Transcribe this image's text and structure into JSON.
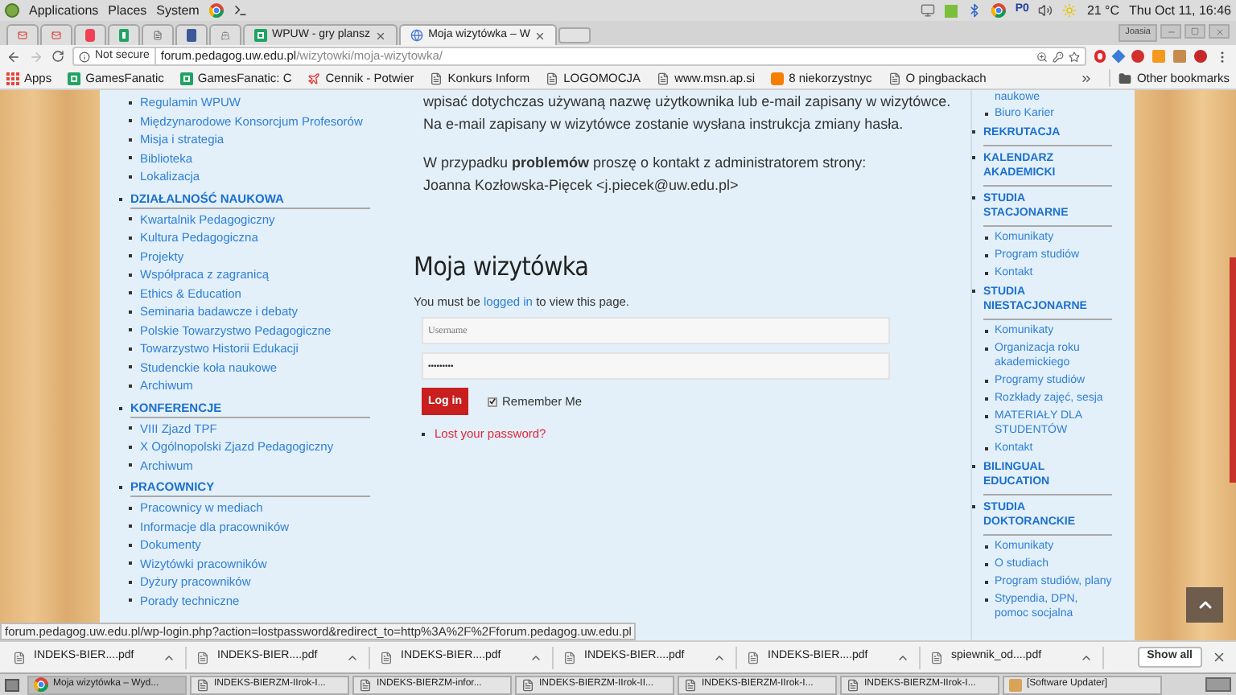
{
  "system_panel": {
    "menus": [
      "Applications",
      "Places",
      "System"
    ],
    "keyboard": "P0",
    "weather": "21 °C",
    "clock": "Thu Oct 11, 16:46"
  },
  "tabs": [
    {
      "kind": "gmail",
      "selected": false
    },
    {
      "kind": "gmail",
      "selected": false
    },
    {
      "kind": "pocket",
      "selected": false
    },
    {
      "kind": "sheets",
      "selected": false
    },
    {
      "kind": "doc",
      "selected": false
    },
    {
      "kind": "facebook",
      "selected": false
    },
    {
      "kind": "ship",
      "selected": false
    },
    {
      "kind": "sheets",
      "title": "WPUW - gry plansz",
      "selected": false
    },
    {
      "kind": "globe",
      "title": "Moja wizytówka – W",
      "selected": true
    }
  ],
  "profile": "Joasia",
  "address_bar": {
    "security": "Not secure",
    "host": "forum.pedagog.uw.edu.pl",
    "path": "/wizytowki/moja-wizytowka/"
  },
  "bookmarks": [
    {
      "kind": "apps",
      "label": "Apps"
    },
    {
      "kind": "sheets",
      "label": "GamesFanatic"
    },
    {
      "kind": "sheets",
      "label": "GamesFanatic: C"
    },
    {
      "kind": "plane",
      "label": "Cennik - Potwier"
    },
    {
      "kind": "doc",
      "label": "Konkurs Inform"
    },
    {
      "kind": "doc",
      "label": "LOGOMOCJA"
    },
    {
      "kind": "doc",
      "label": "www.msn.ap.si"
    },
    {
      "kind": "blogger",
      "label": "8 niekorzystnyc"
    },
    {
      "kind": "doc",
      "label": "O pingbackach"
    }
  ],
  "other_bookmarks": "Other bookmarks",
  "left_menu": [
    {
      "items": [
        "Regulamin WPUW",
        "Międzynarodowe Konsorcjum Profesorów",
        "Misja i strategia",
        "Biblioteka",
        "Lokalizacja"
      ]
    },
    {
      "heading": "DZIAŁALNOŚĆ NAUKOWA",
      "items": [
        "Kwartalnik Pedagogiczny",
        "Kultura Pedagogiczna",
        "Projekty",
        "Współpraca z zagranicą",
        "Ethics & Education",
        "Seminaria badawcze i debaty",
        "Polskie Towarzystwo Pedagogiczne",
        "Towarzystwo Historii Edukacji",
        "Studenckie koła naukowe",
        "Archiwum"
      ]
    },
    {
      "heading": "KONFERENCJE",
      "items": [
        "VIII Zjazd TPF",
        "X Ogólnopolski Zjazd Pedagogiczny",
        "Archiwum"
      ]
    },
    {
      "heading": "PRACOWNICY",
      "items": [
        "Pracownicy w mediach",
        "Informacje dla pracowników",
        "Dokumenty",
        "Wizytówki pracowników",
        "Dyżury pracowników",
        "Porady techniczne"
      ]
    }
  ],
  "content": {
    "paragraphs": [
      [
        "wpisać dotychczas używaną nazwę użytkownika lub e-mail zapisany w wizytówce.",
        "Na e-mail zapisany w wizytówce zostanie wysłana instrukcja zmiany hasła."
      ],
      [
        "W przypadku **problemów** proszę o kontakt z administratorem strony:",
        "Joanna Kozłowska-Pięcek <j.piecek@uw.edu.pl>"
      ]
    ],
    "heading": "Moja wizytówka",
    "notice_before": "You must be",
    "notice_link": "logged in",
    "notice_after": "to view this page.",
    "username_placeholder": "Username",
    "password_value": "•••••••••",
    "login_button": "Log in",
    "remember_me": {
      "label": "Remember Me",
      "checked": true
    },
    "lost_password": "Lost your password?"
  },
  "right_menu": {
    "cut_item": "naukowe",
    "sections": [
      {
        "items": [
          "Biuro Karier"
        ]
      },
      {
        "heading": "REKRUTACJA"
      },
      {
        "heading": "KALENDARZ AKADEMICKI"
      },
      {
        "heading": "STUDIA STACJONARNE",
        "items": [
          "Komunikaty",
          "Program studiów",
          "Kontakt"
        ]
      },
      {
        "heading": "STUDIA NIESTACJONARNE",
        "items": [
          "Komunikaty",
          "Organizacja roku akademickiego",
          "Programy studiów",
          "Rozkłady zajęć, sesja",
          "MATERIAŁY DLA STUDENTÓW",
          "Kontakt"
        ]
      },
      {
        "heading": "BILINGUAL EDUCATION"
      },
      {
        "heading": "STUDIA DOKTORANCKIE",
        "items": [
          "Komunikaty",
          "O studiach",
          "Program studiów, plany",
          "Stypendia, DPN, pomoc socjalna"
        ]
      }
    ]
  },
  "status_url": "forum.pedagog.uw.edu.pl/wp-login.php?action=lostpassword&redirect_to=http%3A%2F%2Fforum.pedagog.uw.edu.pl",
  "downloads": [
    "INDEKS-BIER....pdf",
    "INDEKS-BIER....pdf",
    "INDEKS-BIER....pdf",
    "INDEKS-BIER....pdf",
    "INDEKS-BIER....pdf",
    "spiewnik_od....pdf"
  ],
  "show_all": "Show all",
  "taskbar": [
    {
      "kind": "chrome",
      "label": "Moja wizytówka – Wyd...",
      "selected": true
    },
    {
      "kind": "doc",
      "label": "INDEKS-BIERZM-IIrok-I...",
      "selected": false
    },
    {
      "kind": "doc",
      "label": "INDEKS-BIERZM-infor...",
      "selected": false
    },
    {
      "kind": "doc",
      "label": "INDEKS-BIERZM-IIrok-II...",
      "selected": false
    },
    {
      "kind": "doc",
      "label": "INDEKS-BIERZM-IIrok-I...",
      "selected": false
    },
    {
      "kind": "doc",
      "label": "INDEKS-BIERZM-IIrok-I...",
      "selected": false
    },
    {
      "kind": "updater",
      "label": "[Software Updater]",
      "selected": false
    }
  ]
}
